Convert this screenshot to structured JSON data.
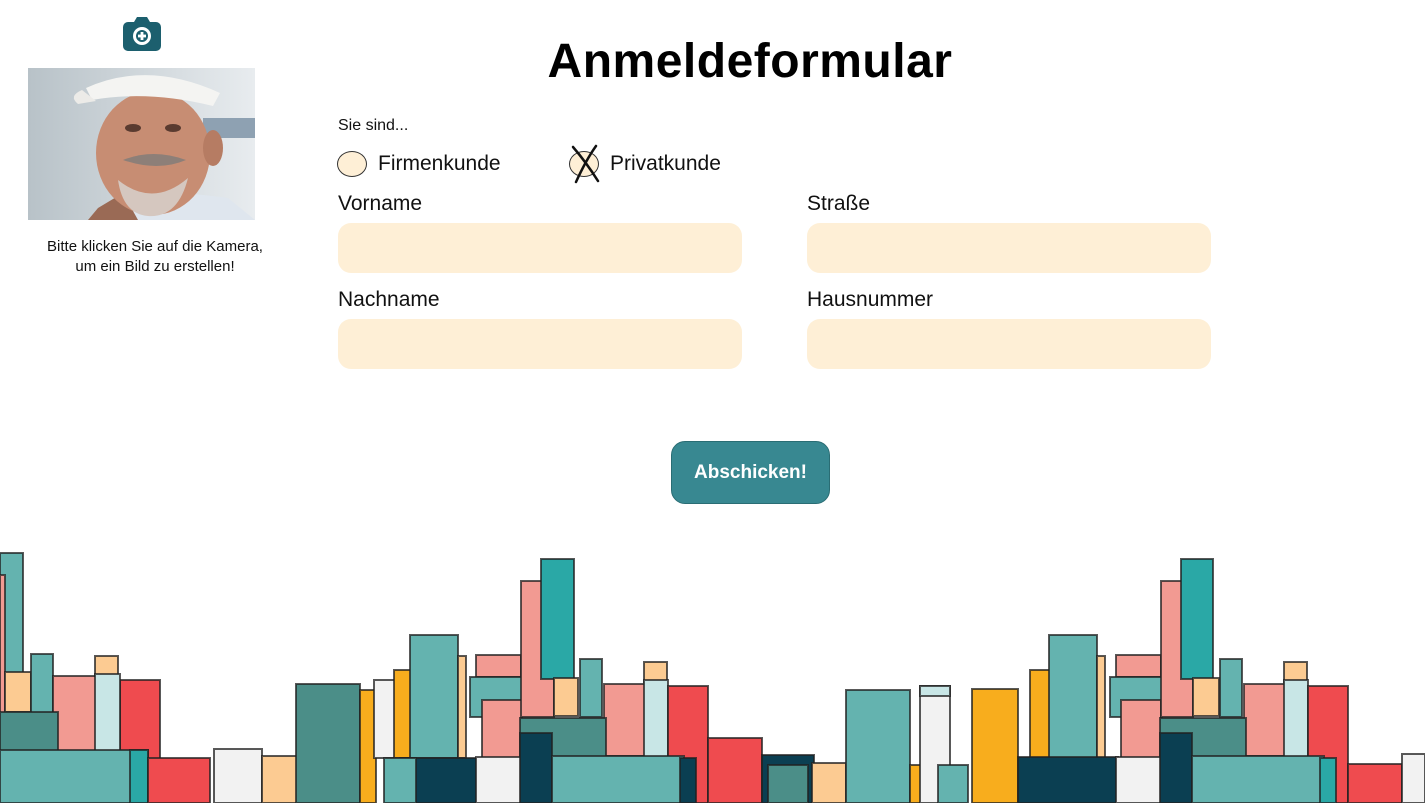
{
  "camera": {
    "icon": "camera-icon"
  },
  "photo": {
    "caption": "Bitte klicken Sie auf die Kamera,\num ein Bild zu erstellen!"
  },
  "form": {
    "title": "Anmeldeformular",
    "question": "Sie sind...",
    "options": [
      {
        "label": "Firmenkunde",
        "selected": false
      },
      {
        "label": "Privatkunde",
        "selected": true
      }
    ],
    "fields": {
      "vorname": {
        "label": "Vorname",
        "value": ""
      },
      "strasse": {
        "label": "Straße",
        "value": ""
      },
      "nachname": {
        "label": "Nachname",
        "value": ""
      },
      "hausnummer": {
        "label": "Hausnummer",
        "value": ""
      }
    },
    "submit_label": "Abschicken!"
  },
  "colors": {
    "accent": "#388891",
    "camera": "#1c5f6e",
    "input_bg": "#feefd6",
    "skyline": [
      "#64b3af",
      "#f29a92",
      "#ef4b4f",
      "#f8ad1d",
      "#0b3f52",
      "#2aa8a6",
      "#fccb92",
      "#c8e6e6",
      "#4b8e88",
      "#f2f2f2"
    ]
  }
}
